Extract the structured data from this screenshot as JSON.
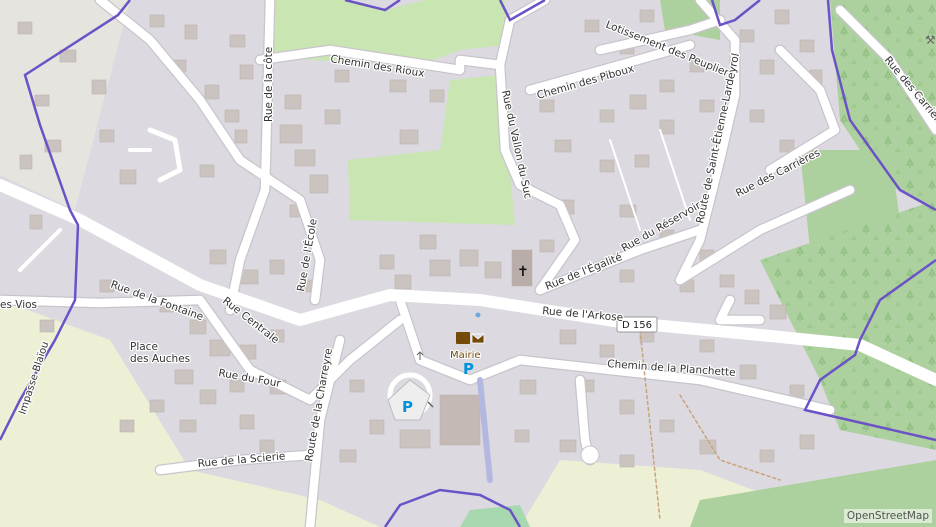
{
  "map": {
    "attribution": "OpenStreetMap",
    "road_shield": "D 156",
    "poi": {
      "townhall": "Mairie",
      "parking": "P",
      "place_of_worship": "✝"
    },
    "colors": {
      "background": "#ddd9e0",
      "road": "#ffffff",
      "road_casing": "#c9c4cc",
      "building": "#cbc3bf",
      "grass": "#c8e5b2",
      "forest": "#add19e",
      "farmland": "#eef0d5",
      "boundary": "#6b52c7",
      "parking_blue": "#0092da"
    },
    "streets": [
      {
        "id": "chemin-des-rioux",
        "name": "Chemin des Rioux"
      },
      {
        "id": "rue-de-la-cote",
        "name": "Rue de la côte"
      },
      {
        "id": "rue-du-vallon-du-suc",
        "name": "Rue du Vallon du Suc"
      },
      {
        "id": "lotissement-des-peupliers",
        "name": "Lotissement des Peupliers"
      },
      {
        "id": "chemin-des-piboux",
        "name": "Chemin des Piboux"
      },
      {
        "id": "route-de-saint-etienne-lardeyrol",
        "name": "Route de Saint-Étienne-Lardeyrol"
      },
      {
        "id": "rue-des-carrieres-1",
        "name": "Rue des Carrières"
      },
      {
        "id": "rue-des-carrieres-2",
        "name": "Rue des Carrières"
      },
      {
        "id": "rue-de-l-ecole",
        "name": "Rue de l'École"
      },
      {
        "id": "rue-du-reservoir",
        "name": "Rue du Réservoir"
      },
      {
        "id": "rue-de-l-egalite",
        "name": "Rue de l'Égalité"
      },
      {
        "id": "rue-de-la-fontaine",
        "name": "Rue de la Fontaine"
      },
      {
        "id": "rue-centrale",
        "name": "Rue Centrale"
      },
      {
        "id": "rue-de-l-arkose",
        "name": "Rue de l'Arkose"
      },
      {
        "id": "chemin-de-la-planchette",
        "name": "Chemin de la Planchette"
      },
      {
        "id": "rue-du-four",
        "name": "Rue du Four"
      },
      {
        "id": "route-de-la-charreyre",
        "name": "Route de la Charreyre"
      },
      {
        "id": "rue-de-la-scierie",
        "name": "Rue de la Scierie"
      },
      {
        "id": "impasse-blaiou",
        "name": "Impasse Blaïou"
      },
      {
        "id": "rue-des-vios",
        "name": "es Vios"
      }
    ],
    "places": [
      {
        "id": "place-des-auches",
        "line1": "Place",
        "line2": "des Auches"
      }
    ]
  }
}
